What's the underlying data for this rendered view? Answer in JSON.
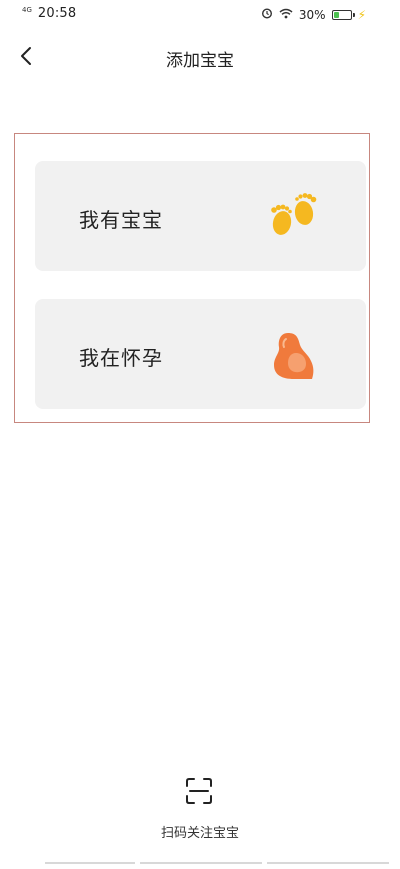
{
  "status_bar": {
    "network": "4G",
    "time": "20:58",
    "battery_percent": "30%",
    "battery_level": 0.3
  },
  "header": {
    "title": "添加宝宝"
  },
  "options": [
    {
      "label": "我有宝宝",
      "icon": "baby-feet-icon"
    },
    {
      "label": "我在怀孕",
      "icon": "pregnancy-icon"
    }
  ],
  "scan": {
    "label": "扫码关注宝宝",
    "icon": "scan-icon"
  },
  "colors": {
    "card_bg": "#f1f1f1",
    "highlight_border": "#c7877f",
    "feet_yellow": "#f5b820",
    "pregnancy_orange": "#f07a3c"
  }
}
